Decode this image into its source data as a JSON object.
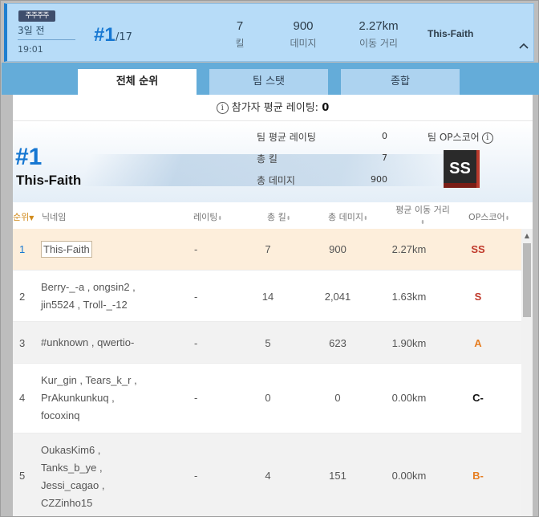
{
  "summary": {
    "badge": "주주주주",
    "ago": "3일 전",
    "time": "19:01",
    "rank": "#1",
    "rank_total": "/17",
    "kills_value": "7",
    "kills_label": "킬",
    "damage_value": "900",
    "damage_label": "데미지",
    "distance_value": "2.27km",
    "distance_label": "이동 거리",
    "player": "This-Faith",
    "collapse_icon": "chevron-up-icon"
  },
  "tabs": [
    {
      "label": "전체 순위",
      "active": true
    },
    {
      "label": "팀 스탯",
      "active": false
    },
    {
      "label": "종합",
      "active": false
    }
  ],
  "avg_rating": {
    "label": "참가자 평균 레이팅:",
    "value": "0"
  },
  "team": {
    "rank": "#1",
    "name": "This-Faith",
    "stats": [
      {
        "label": "팀 평균 레이팅",
        "value": "0"
      },
      {
        "label": "총 킬",
        "value": "7"
      },
      {
        "label": "총 데미지",
        "value": "900"
      }
    ],
    "op_label": "팀 OP스코어",
    "op_grade": "SS"
  },
  "table": {
    "headers": {
      "rank": "순위",
      "name": "닉네임",
      "rating": "레이팅",
      "kills": "총 킬",
      "damage": "총 데미지",
      "distance": "평균 이동 거리",
      "op": "OP스코어"
    },
    "rows": [
      {
        "rank": "1",
        "names": [
          "This-Faith"
        ],
        "rating": "-",
        "kills": "7",
        "damage": "900",
        "distance": "2.27km",
        "op": "SS"
      },
      {
        "rank": "2",
        "names": [
          "Berry-_-a , ongsin2 ,",
          "jin5524 , Troll-_-12"
        ],
        "rating": "-",
        "kills": "14",
        "damage": "2,041",
        "distance": "1.63km",
        "op": "S"
      },
      {
        "rank": "3",
        "names": [
          "#unknown , qwertio-"
        ],
        "rating": "-",
        "kills": "5",
        "damage": "623",
        "distance": "1.90km",
        "op": "A"
      },
      {
        "rank": "4",
        "names": [
          "Kur_gin , Tears_k_r ,",
          "PrAkunkunkuq ,",
          "focoxinq"
        ],
        "rating": "-",
        "kills": "0",
        "damage": "0",
        "distance": "0.00km",
        "op": "C-"
      },
      {
        "rank": "5",
        "names": [
          "OukasKim6 ,",
          "Tanks_b_ye ,",
          "Jessi_cagao ,",
          "CZZinho15"
        ],
        "rating": "-",
        "kills": "4",
        "damage": "151",
        "distance": "0.00km",
        "op": "B-"
      }
    ]
  },
  "colors": {
    "accent": "#1677d2",
    "op_ss": "#c0392b",
    "op_s": "#c0392b",
    "op_a": "#e67e22",
    "op_c": "#111111",
    "op_b": "#e67e22"
  }
}
